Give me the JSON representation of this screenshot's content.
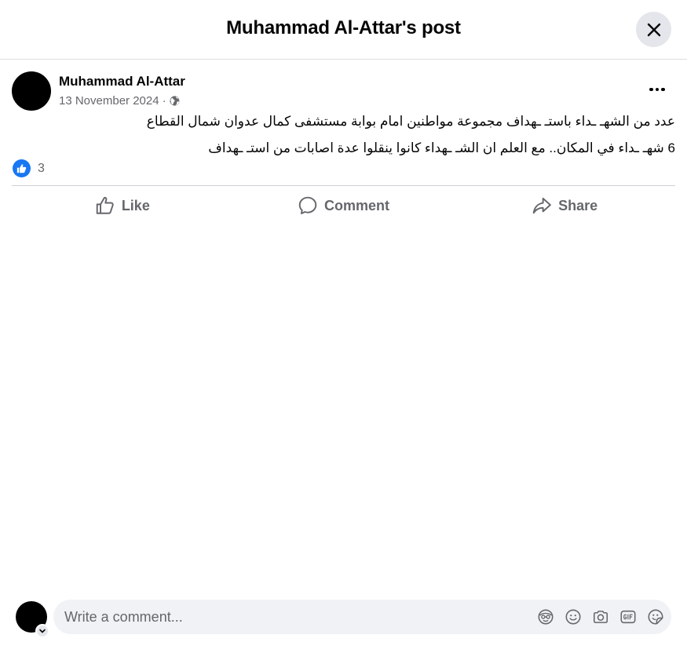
{
  "header": {
    "title": "Muhammad Al-Attar's post"
  },
  "post": {
    "author": "Muhammad Al-Attar",
    "date": "13 November 2024",
    "separator": "·",
    "privacy_icon": "globe-icon",
    "text_lines": [
      "عدد من الشهـ ـداء باستـ ـهداف مجموعة مواطنين امام بوابة مستشفى كمال عدوان شمال القطاع",
      "6 شهـ ـداء في المكان.. مع العلم ان الشـ ـهداء كانوا ينقلوا عدة اصابات من استـ ـهداف"
    ],
    "reaction_icon": "like-reaction-icon",
    "reaction_count": "3"
  },
  "actions": {
    "like": "Like",
    "comment": "Comment",
    "share": "Share"
  },
  "composer": {
    "placeholder": "Write a comment...",
    "tools": [
      "avatar-sticker-icon",
      "emoji-icon",
      "camera-icon",
      "gif-icon",
      "sticker-icon"
    ]
  },
  "colors": {
    "accent": "#1877f2",
    "secondary_text": "#65676b",
    "input_bg": "#f0f2f5",
    "close_bg": "#e4e6eb"
  }
}
